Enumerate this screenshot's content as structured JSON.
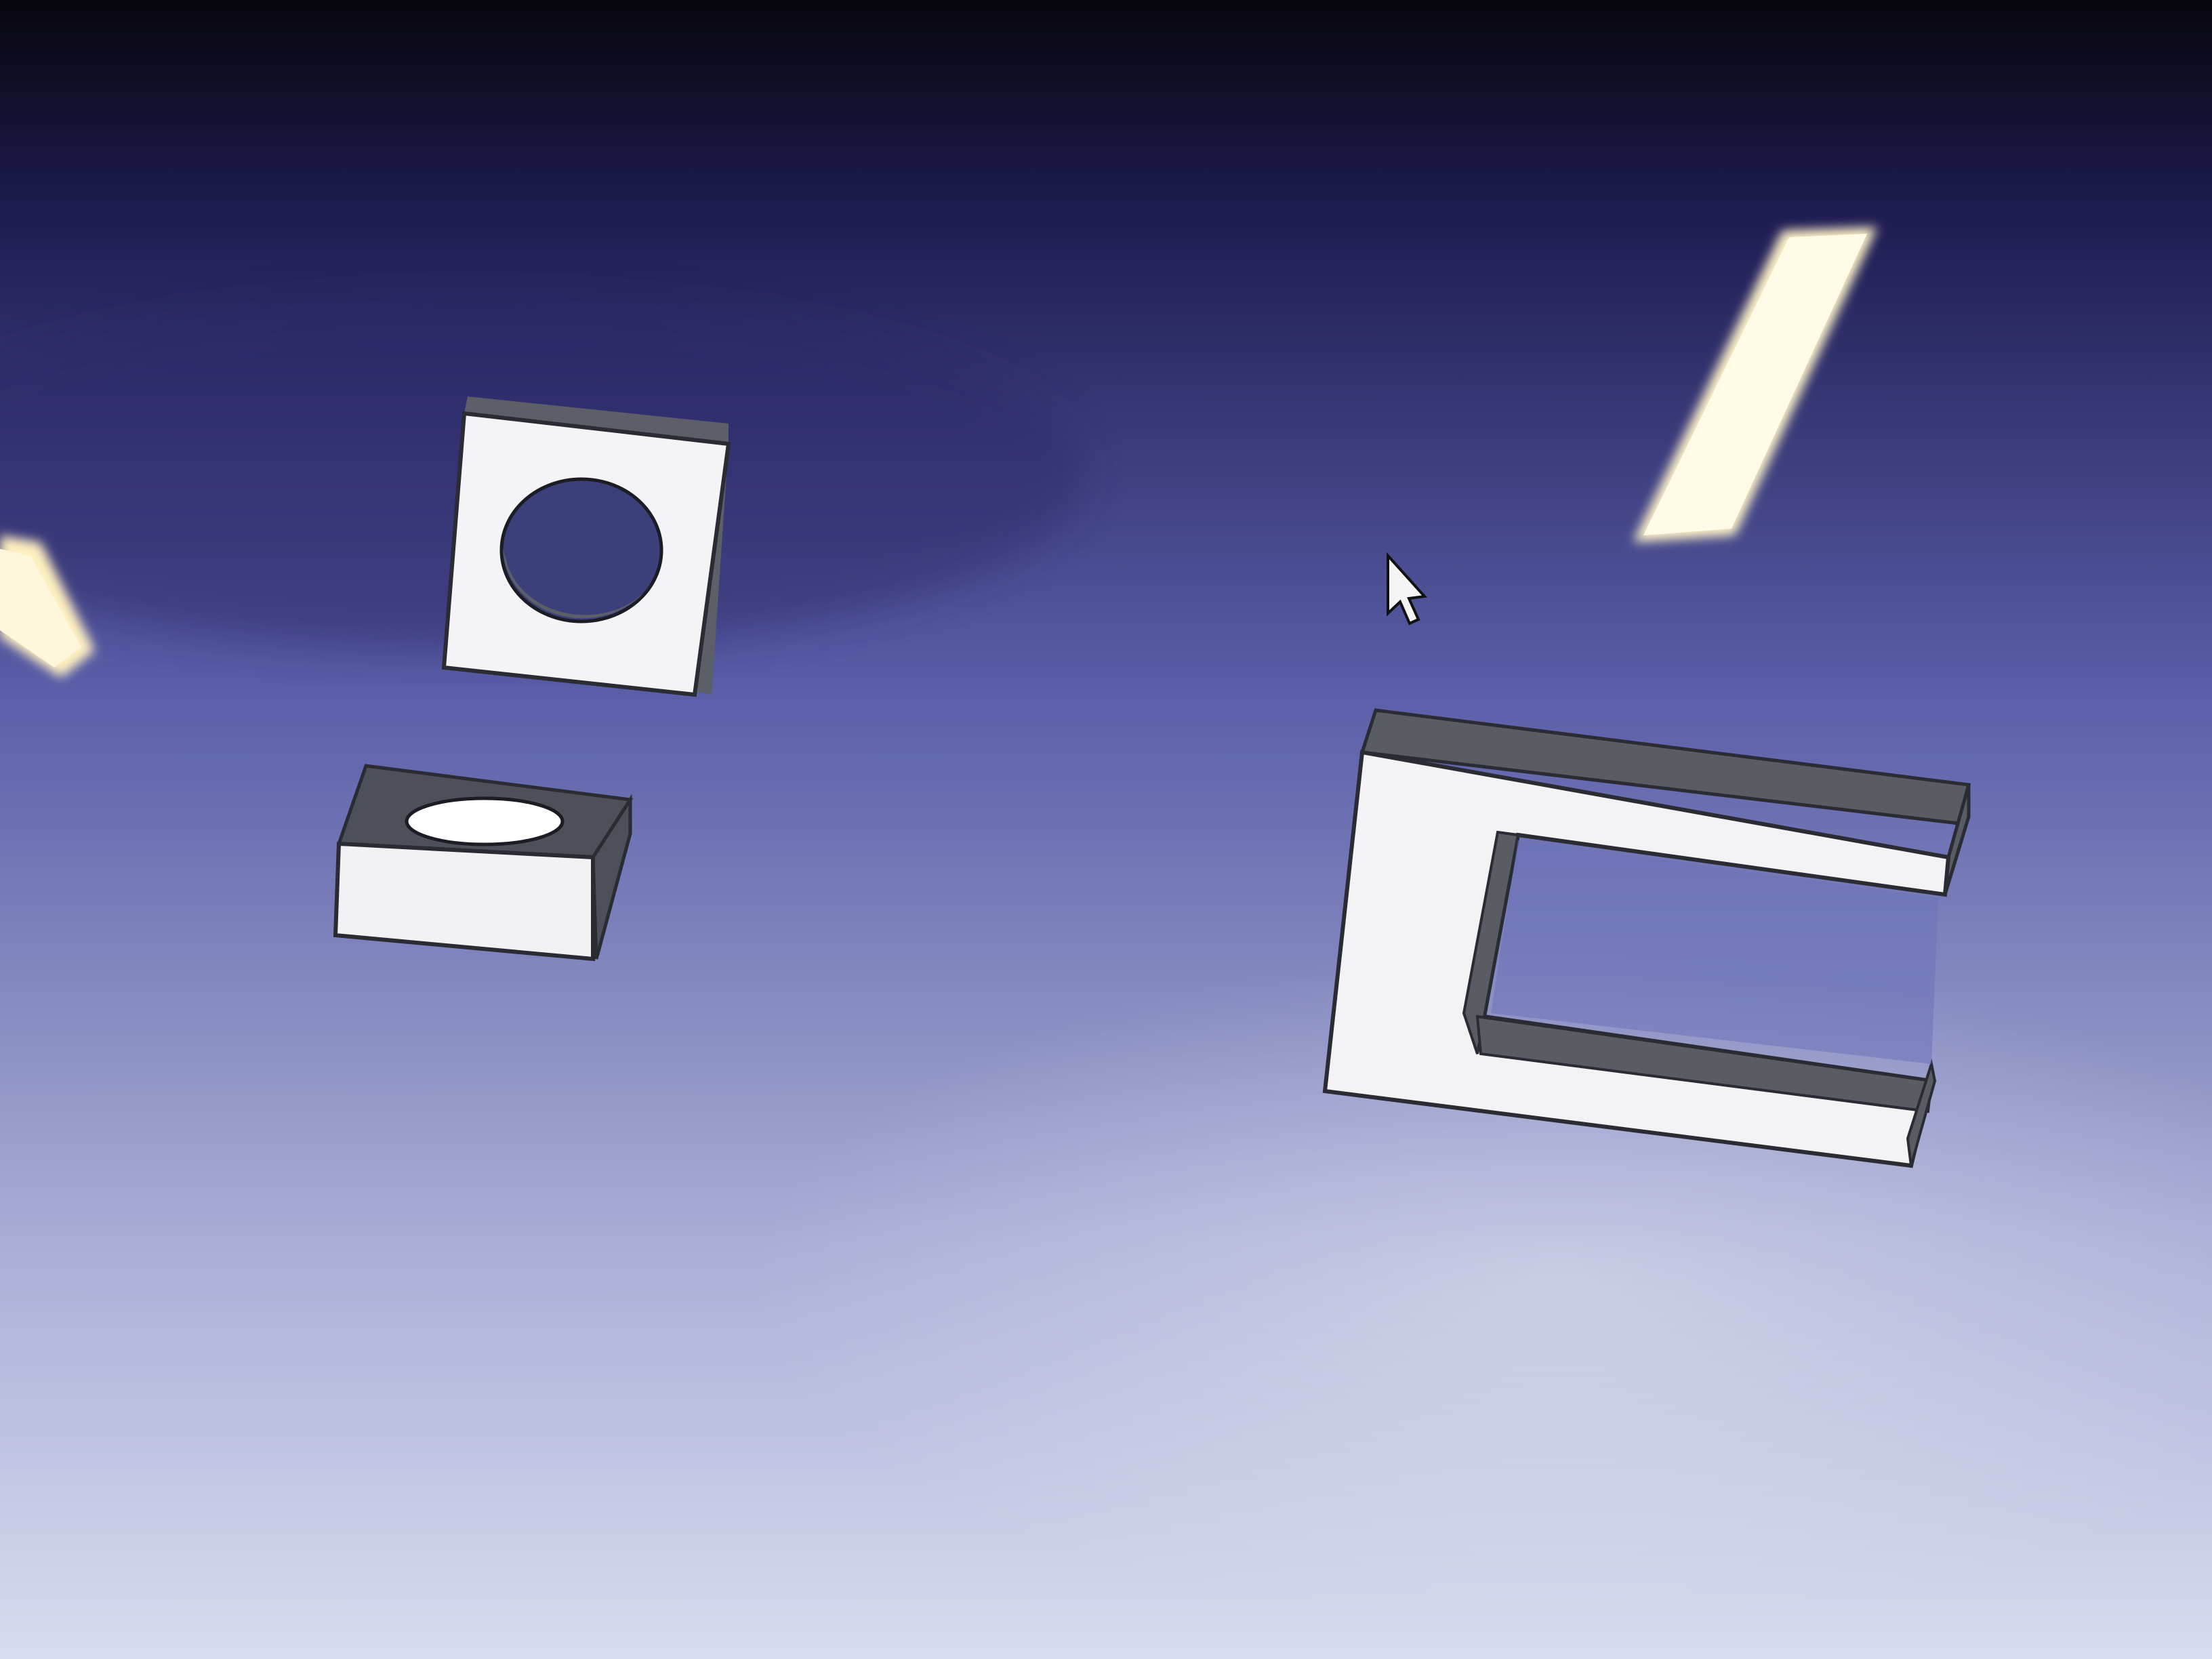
{
  "app": {
    "title": ""
  },
  "viewport": {
    "background": {
      "top": "#07060d",
      "upper": "#1e1c52",
      "middle": "#5a5fa8",
      "lower": "#a9aed6",
      "bottom": "#d8dbf0"
    }
  },
  "scene": {
    "objects": [
      {
        "name": "square-plate-with-hole",
        "kind": "plate-with-circular-hole",
        "face_color": "#f4f4f6",
        "side_color": "#5d5f68",
        "hole_color": "#3b3f7a"
      },
      {
        "name": "block-with-hole",
        "kind": "block-with-elliptical-hole",
        "face_color": "#f2f2f4",
        "side_color": "#4e5059",
        "hole_color": "#ffffff"
      },
      {
        "name": "u-channel",
        "kind": "u-shaped-profile",
        "face_color": "#f3f3f5",
        "side_color": "#5a5c64"
      }
    ],
    "cursor": {
      "icon": "arrow-cursor-icon",
      "color": "#f5f5f5",
      "outline": "#111111"
    },
    "reflections": [
      {
        "name": "ceiling-light-reflection-right",
        "color": "#fff3c8"
      },
      {
        "name": "ceiling-light-reflection-left",
        "color": "#fff0c0"
      }
    ]
  }
}
